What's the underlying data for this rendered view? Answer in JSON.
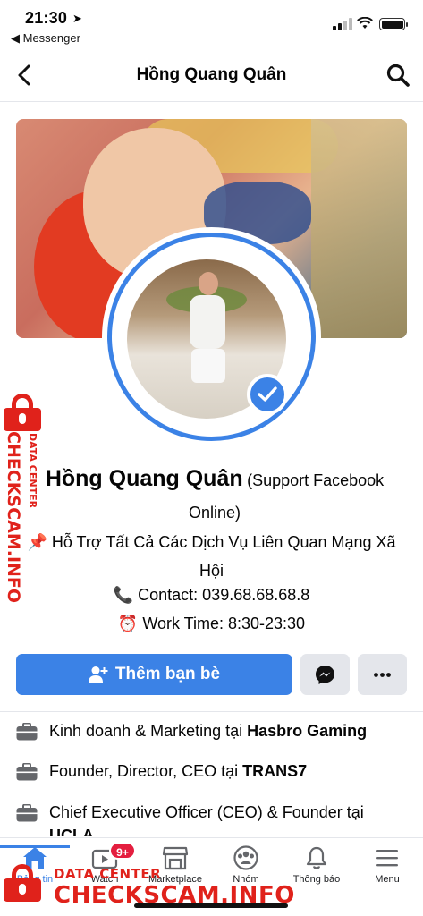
{
  "status_bar": {
    "time": "21:30",
    "back_app": "◀ Messenger"
  },
  "header": {
    "title": "Hồng Quang Quân"
  },
  "profile": {
    "name": "Hồng Quang Quân",
    "name_suffix": "(Support Facebook Online)",
    "bio_line1": "📌 Hỗ Trợ Tất Cả Các Dịch Vụ Liên Quan Mạng Xã Hội",
    "bio_line2": "📞 Contact: 039.68.68.68.8",
    "bio_line3": "⏰ Work Time: 8:30-23:30"
  },
  "actions": {
    "add_friend_label": "Thêm bạn bè"
  },
  "work": [
    {
      "prefix": "Kinh doanh & Marketing tại ",
      "company": "Hasbro Gaming"
    },
    {
      "prefix": "Founder, Director, CEO tại ",
      "company": "TRANS7"
    },
    {
      "prefix": "Chief Executive Officer (CEO) & Founder tại ",
      "company": "UCLA"
    }
  ],
  "tabbar": {
    "items": [
      {
        "label": "Bảng tin",
        "icon": "home-icon"
      },
      {
        "label": "Watch",
        "icon": "watch-icon",
        "badge": "9+"
      },
      {
        "label": "Marketplace",
        "icon": "marketplace-icon"
      },
      {
        "label": "Nhóm",
        "icon": "groups-icon"
      },
      {
        "label": "Thông báo",
        "icon": "bell-icon"
      },
      {
        "label": "Menu",
        "icon": "menu-icon"
      }
    ]
  },
  "watermark": {
    "side_small": "DATA CENTER",
    "side_big": "CHECKSCAM.INFO",
    "bottom_small": "DATA CENTER",
    "bottom_big": "CHECKSCAM.INFO"
  },
  "colors": {
    "accent": "#3b82e6",
    "badge": "#e41e3f",
    "watermark": "#e0221b"
  }
}
